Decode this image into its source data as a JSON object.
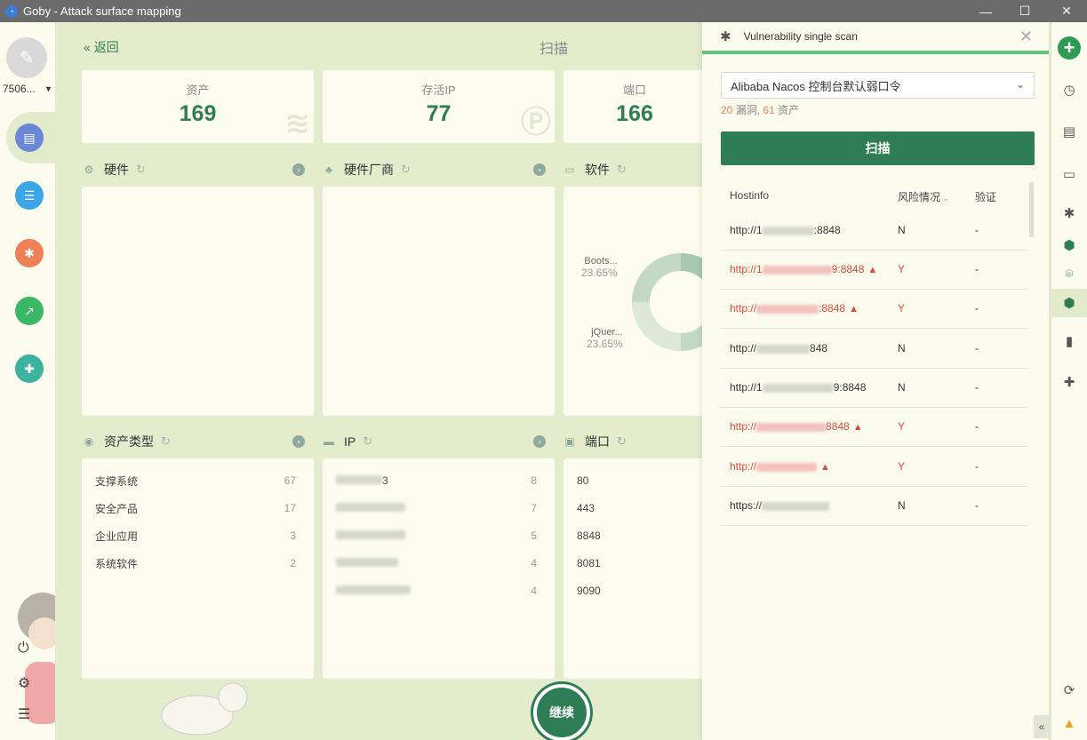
{
  "window": {
    "title": "Goby - Attack surface mapping"
  },
  "sidebar": {
    "workspace": "7506..."
  },
  "header": {
    "back": "返回",
    "title": "扫描"
  },
  "stats": [
    {
      "label": "资产",
      "value": "169"
    },
    {
      "label": "存活IP",
      "value": "77"
    },
    {
      "label": "端口",
      "value": "166"
    }
  ],
  "sections": {
    "hardware": "硬件",
    "vendor": "硬件厂商",
    "software": "软件",
    "asset_type": "资产类型",
    "ip": "IP",
    "port": "端口"
  },
  "software_donut": [
    {
      "label": "Boots...",
      "pct": "23.65%"
    },
    {
      "label": "jQuer...",
      "pct": "23.65%"
    }
  ],
  "asset_types": [
    {
      "name": "支撑系统",
      "count": "67"
    },
    {
      "name": "安全产品",
      "count": "17"
    },
    {
      "name": "企业应用",
      "count": "3"
    },
    {
      "name": "系统软件",
      "count": "2"
    }
  ],
  "ip_list": [
    {
      "suffix": "3",
      "count": "8"
    },
    {
      "suffix": "",
      "count": "7"
    },
    {
      "suffix": "",
      "count": "5"
    },
    {
      "suffix": "",
      "count": "4"
    },
    {
      "suffix": "",
      "count": "4"
    }
  ],
  "port_list": [
    "80",
    "443",
    "8848",
    "8081",
    "9090"
  ],
  "continue_label": "继续",
  "drawer": {
    "title": "Vulnerability single scan",
    "selected_vuln": "Alibaba Nacos 控制台默认弱口令",
    "vuln_count": "20",
    "vuln_label": "漏洞,",
    "asset_count": "61",
    "asset_label": "资产",
    "scan_label": "扫描",
    "columns": {
      "host": "Hostinfo",
      "risk": "风险情况",
      "verify": "验证"
    },
    "rows": [
      {
        "prefix": "http://1",
        "suffix": ":8848",
        "risk": "N",
        "verify": "-",
        "flag": false
      },
      {
        "prefix": "http://1",
        "suffix": "9:8848",
        "risk": "Y",
        "verify": "-",
        "flag": true
      },
      {
        "prefix": "http://",
        "suffix": ":8848",
        "risk": "Y",
        "verify": "-",
        "flag": true
      },
      {
        "prefix": "http://",
        "suffix": "848",
        "risk": "N",
        "verify": "-",
        "flag": false
      },
      {
        "prefix": "http://1",
        "suffix": "9:8848",
        "risk": "N",
        "verify": "-",
        "flag": false
      },
      {
        "prefix": "http://",
        "suffix": "8848",
        "risk": "Y",
        "verify": "-",
        "flag": true
      },
      {
        "prefix": "http://",
        "suffix": "",
        "risk": "Y",
        "verify": "-",
        "flag": true
      },
      {
        "prefix": "https://",
        "suffix": "",
        "risk": "N",
        "verify": "-",
        "flag": false
      }
    ]
  },
  "colors": {
    "accent": "#2f7d54",
    "risk": "#e0483c",
    "bg": "#e5ebcd"
  }
}
